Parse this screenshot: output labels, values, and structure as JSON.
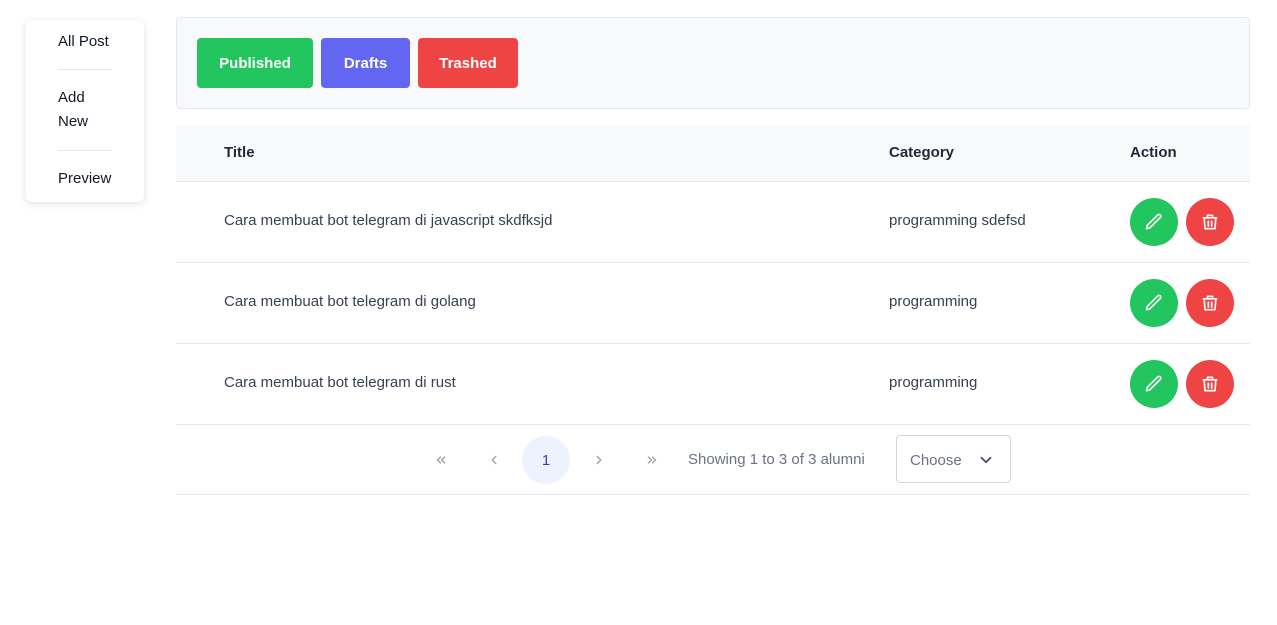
{
  "sidebar": {
    "items": [
      {
        "label": "All Post"
      },
      {
        "label": "Add New"
      },
      {
        "label": "Preview"
      }
    ]
  },
  "toolbar": {
    "published_label": "Published",
    "drafts_label": "Drafts",
    "trashed_label": "Trashed"
  },
  "table": {
    "headers": [
      "Title",
      "Category",
      "Action"
    ],
    "rows": [
      {
        "title": "Cara membuat bot telegram di javascript skdfksjd",
        "category": "programming sdefsd"
      },
      {
        "title": "Cara membuat bot telegram di golang",
        "category": "programming"
      },
      {
        "title": "Cara membuat bot telegram di rust",
        "category": "programming"
      }
    ]
  },
  "pagination": {
    "current_page": "1",
    "showing_text": "Showing 1 to 3 of 3 alumni",
    "per_page_select": "Choose"
  },
  "colors": {
    "success": "#22c55e",
    "primary": "#6366f1",
    "danger": "#ef4444"
  },
  "icons": {
    "edit": "pencil-icon",
    "delete": "trash-icon",
    "first": "chevrons-left-icon",
    "prev": "chevron-left-icon",
    "next": "chevron-right-icon",
    "last": "chevrons-right-icon",
    "dropdown": "chevron-down-icon"
  }
}
